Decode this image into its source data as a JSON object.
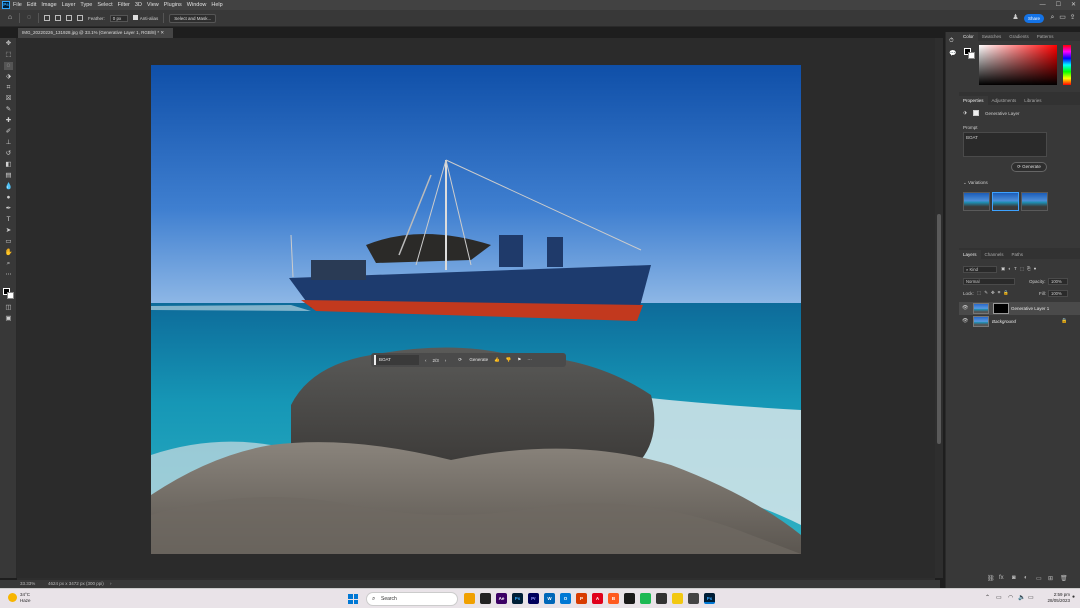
{
  "menu": {
    "app_logo": "Ps",
    "items": [
      "File",
      "Edit",
      "Image",
      "Layer",
      "Type",
      "Select",
      "Filter",
      "3D",
      "View",
      "Plugins",
      "Window",
      "Help"
    ]
  },
  "options": {
    "feather_label": "Feather:",
    "feather_value": "0 px",
    "antialias_label": "Anti-alias",
    "select_mask_label": "Select and Mask...",
    "share_label": "Share"
  },
  "document": {
    "tab_title": "IMG_20220226_131928.jpg @ 33.1% (Generative Layer 1, RGB/8) *"
  },
  "context_bar": {
    "prompt": "BOAT",
    "page": "2/3",
    "generate_label": "Generate"
  },
  "color_panel": {
    "tabs": [
      "Color",
      "Swatches",
      "Gradients",
      "Patterns"
    ]
  },
  "properties": {
    "tabs": [
      "Properties",
      "Adjustments",
      "Libraries"
    ],
    "layer_type": "Generative Layer",
    "prompt_label": "Prompt",
    "prompt_value": "BOAT",
    "generate_label": "Generate",
    "variations_label": "Variations"
  },
  "layers": {
    "tabs": [
      "Layers",
      "Channels",
      "Paths"
    ],
    "kind_label": "Kind",
    "blend_mode": "Normal",
    "opacity_label": "Opacity:",
    "opacity_value": "100%",
    "lock_label": "Lock:",
    "fill_label": "Fill:",
    "fill_value": "100%",
    "items": [
      {
        "name": "Generative Layer 1"
      },
      {
        "name": "Background"
      }
    ]
  },
  "status": {
    "zoom": "33.33%",
    "dimensions": "4624 px x 3472 px (300 ppi)"
  },
  "windows": {
    "temperature": "34°C",
    "weather": "Haze",
    "search_placeholder": "Search",
    "time": "2:59 pm",
    "date": "28/05/2023"
  }
}
